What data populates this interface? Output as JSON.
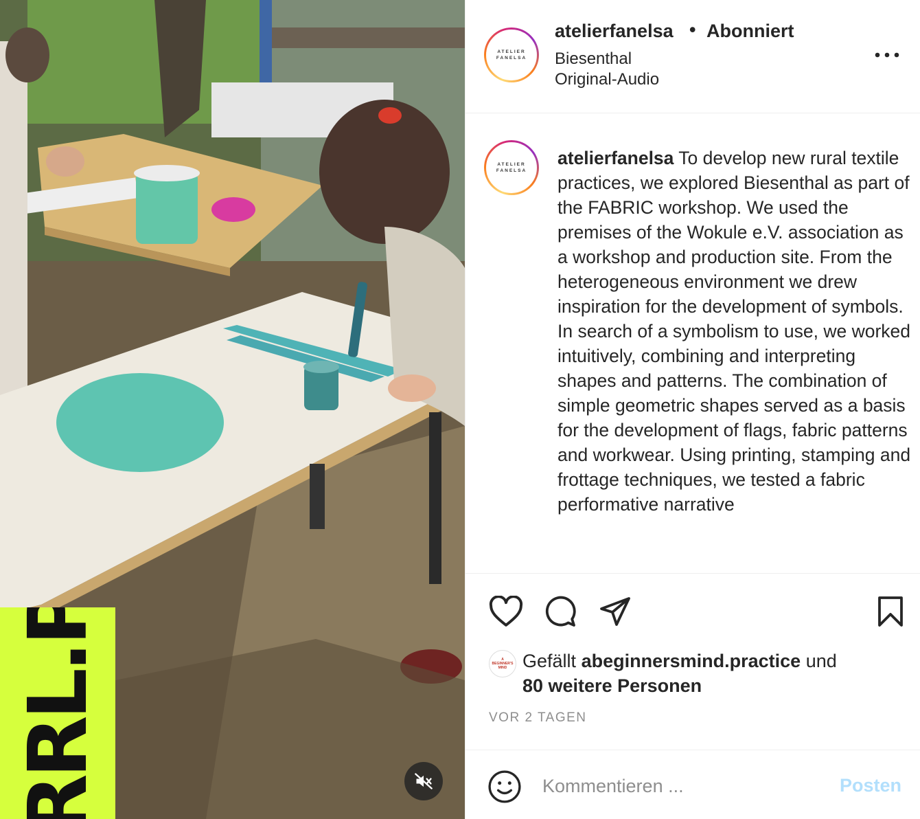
{
  "post": {
    "username": "atelierfanelsa",
    "separator": "•",
    "follow_status": "Abonniert",
    "location": "Biesenthal",
    "audio": "Original-Audio",
    "avatar_text_line1": "ATELIER",
    "avatar_text_line2": "FANELSA"
  },
  "caption": {
    "username": "atelierfanelsa",
    "text": "To develop new rural textile practices, we explored Biesenthal as part of the FABRIC workshop. We used the premises of the Wokule e.V. association as a workshop and production site. From the heterogeneous environment we drew inspiration for the development of symbols. In search of a symbolism to use, we worked intuitively, combining and interpreting shapes and patterns. The combination of simple geometric shapes served as a basis for the development of flags, fabric patterns and workwear. Using printing, stamping and frottage techniques, we tested a fabric performative narrative"
  },
  "media": {
    "sticker_text": "RRL.P",
    "sticker_color": "#d6ff3d",
    "mute_icon": "speaker-muted-icon"
  },
  "actions": {
    "like_icon": "heart-icon",
    "comment_icon": "comment-icon",
    "share_icon": "paper-plane-icon",
    "save_icon": "bookmark-icon"
  },
  "likes": {
    "prefix": "Gefällt",
    "user": "abeginnersmind.practice",
    "conjunction": "und",
    "others": "80 weitere Personen",
    "avatar_line1": "A",
    "avatar_line2": "BEGINNER'S",
    "avatar_line3": "MIND"
  },
  "timestamp": "VOR 2 TAGEN",
  "comment": {
    "placeholder": "Kommentieren ...",
    "post_label": "Posten",
    "emoji_icon": "smiley-icon"
  },
  "colors": {
    "text": "#262626",
    "muted": "#8e8e8e",
    "post_disabled": "#b2dffc",
    "divider": "#efefef"
  }
}
